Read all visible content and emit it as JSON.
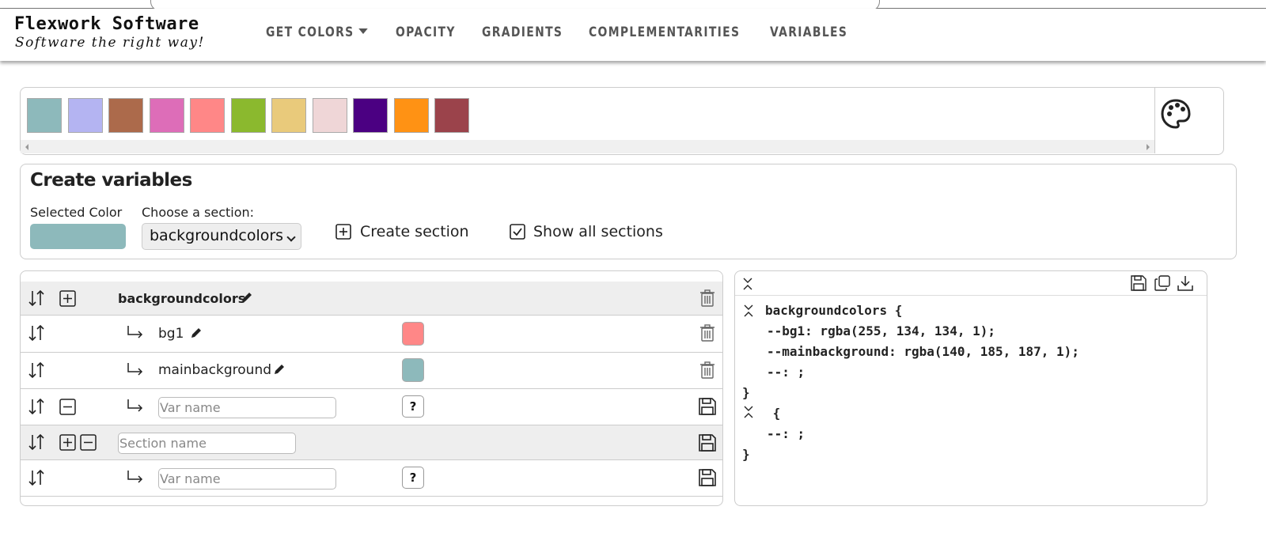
{
  "header": {
    "brand_name": "Flexwork Software",
    "brand_tagline": "Software the right way!",
    "nav": {
      "get_colors": "GET COLORS",
      "opacity": "OPACITY",
      "gradients": "GRADIENTS",
      "complementarities": "COMPLEMENTARITIES",
      "variables": "VARIABLES"
    }
  },
  "palette": {
    "swatches": [
      "#8db9bb",
      "#b4b4f2",
      "#ac6a4b",
      "#dd6db8",
      "#ff8787",
      "#8bb92e",
      "#e9ca7b",
      "#efd6d7",
      "#4b0082",
      "#ff9214",
      "#9b434b"
    ],
    "icon": "palette-icon"
  },
  "create": {
    "title": "Create variables",
    "selected_color_label": "Selected Color",
    "selected_color": "#8db9bb",
    "choose_section_label": "Choose a section:",
    "section_value": "backgroundcolors",
    "create_section_label": "Create section",
    "show_all_label": "Show all sections",
    "show_all_checked": true
  },
  "table": {
    "section_name": "backgroundcolors",
    "vars": [
      {
        "name": "bg1",
        "color": "#ff8787"
      },
      {
        "name": "mainbackground",
        "color": "#8db9bb"
      }
    ],
    "var_placeholder": "Var name",
    "section_placeholder": "Section name",
    "question": "?"
  },
  "code": {
    "line1": "backgroundcolors {",
    "line2": "--bg1: rgba(255, 134, 134, 1);",
    "line3": "--mainbackground: rgba(140, 185, 187, 1);",
    "line4": "--: ;",
    "line5": "}",
    "line6": " {",
    "line7": "--: ;",
    "line8": "}"
  }
}
